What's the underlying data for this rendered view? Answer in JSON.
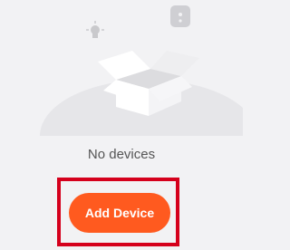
{
  "empty_state": {
    "message": "No devices",
    "illustration_icons": [
      "bulb-icon",
      "smart-plug-icon",
      "open-box-icon"
    ]
  },
  "actions": {
    "add_device_label": "Add Device"
  },
  "colors": {
    "background": "#f2f2f4",
    "accent": "#ff5a1f",
    "highlight": "#d5001c"
  }
}
